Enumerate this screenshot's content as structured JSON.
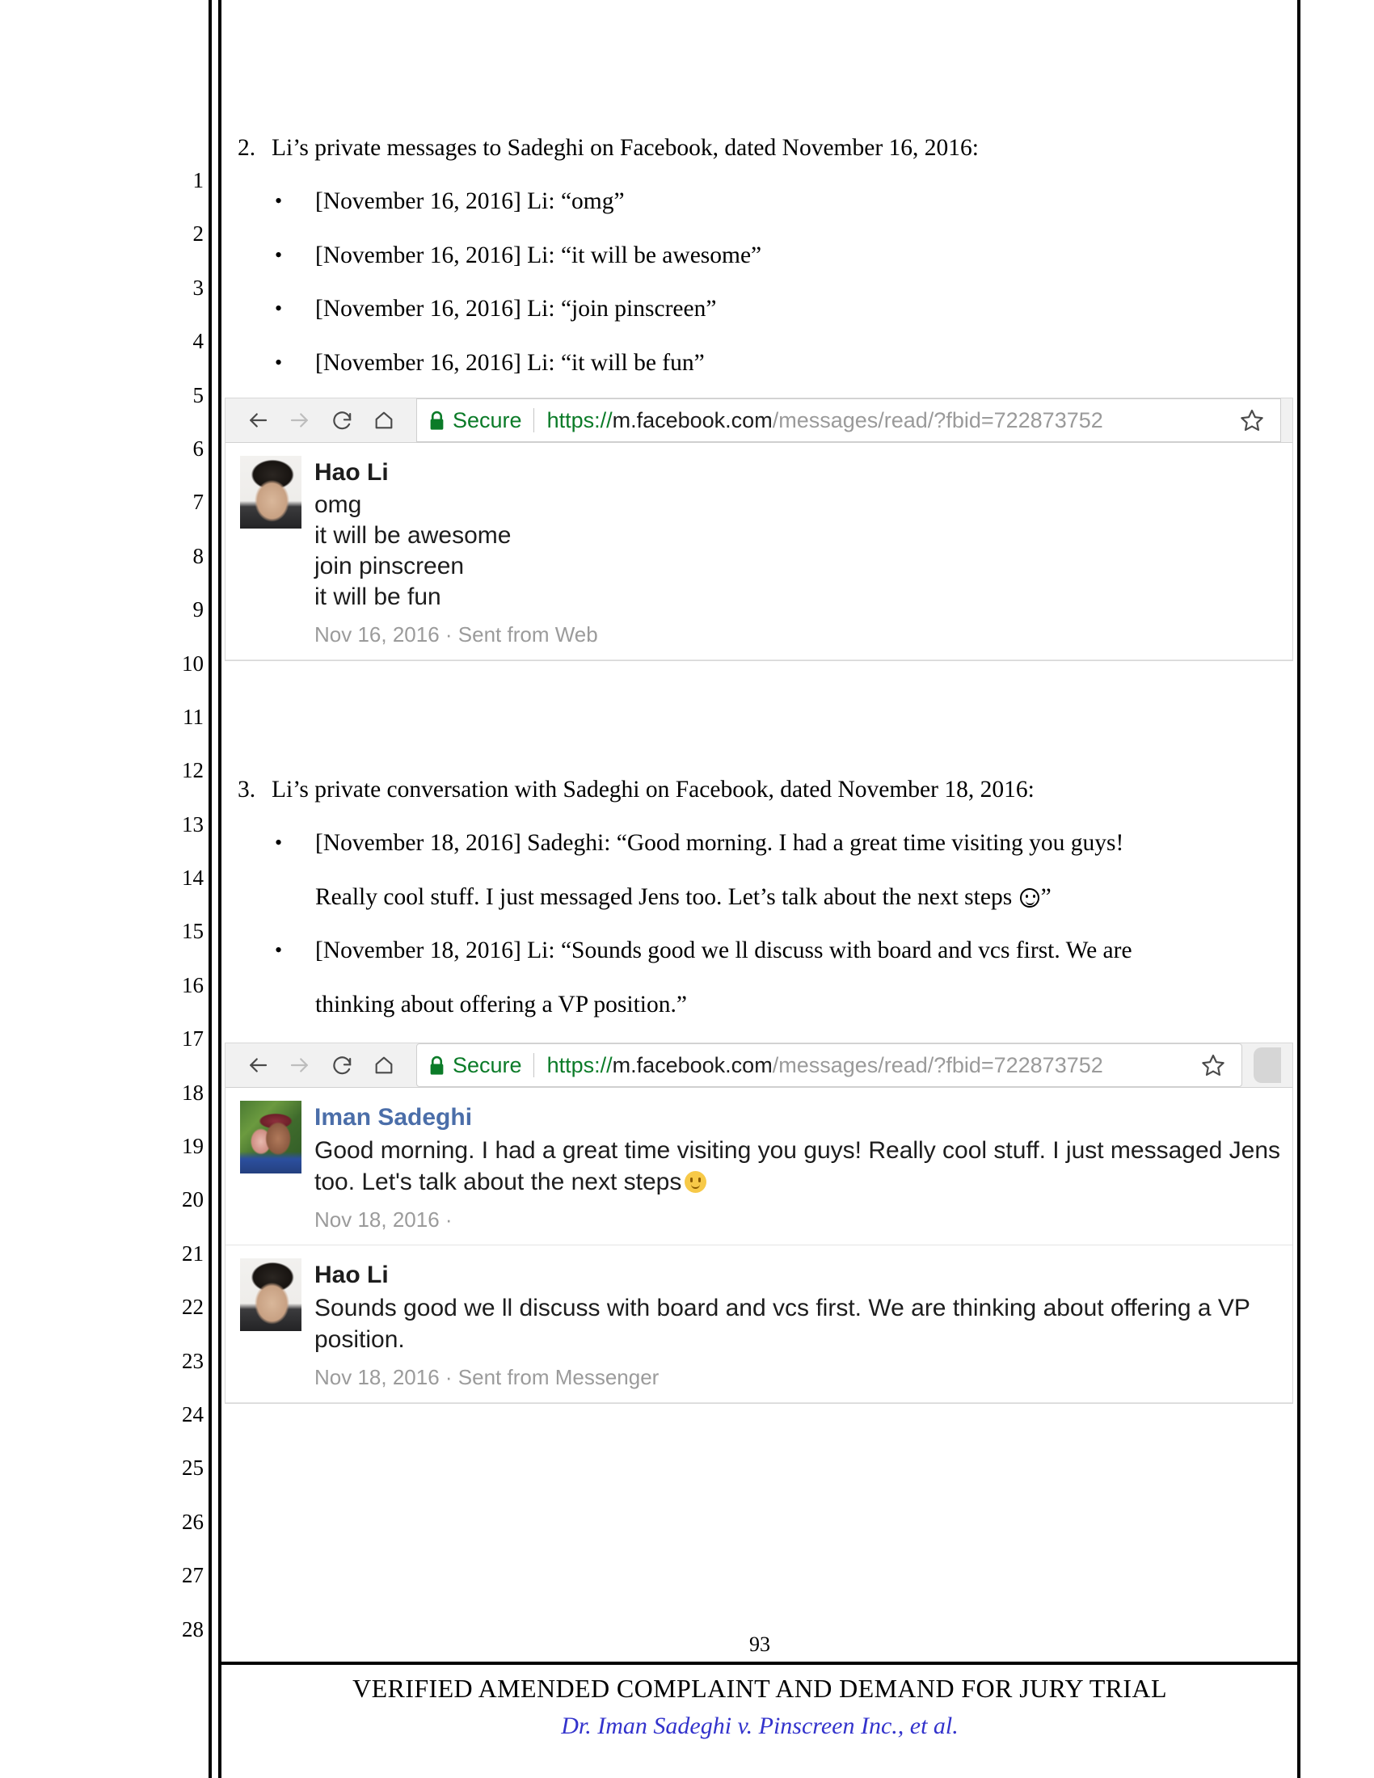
{
  "document": {
    "line_numbers": [
      "1",
      "2",
      "3",
      "4",
      "5",
      "6",
      "7",
      "8",
      "9",
      "10",
      "11",
      "12",
      "13",
      "14",
      "15",
      "16",
      "17",
      "18",
      "19",
      "20",
      "21",
      "22",
      "23",
      "24",
      "25",
      "26",
      "27",
      "28"
    ]
  },
  "section2": {
    "number": "2.",
    "heading": "Li’s private messages to Sadeghi on Facebook, dated November 16, 2016:",
    "bullet_glyph": "•",
    "bullets": [
      "[November 16, 2016] Li: “omg”",
      "[November 16, 2016] Li: “it will be awesome”",
      "[November 16, 2016] Li: “join pinscreen”",
      "[November 16, 2016] Li: “it will be fun”"
    ]
  },
  "screenshot1": {
    "browser": {
      "back_icon": "back-arrow-icon",
      "forward_icon": "forward-arrow-icon",
      "reload_icon": "reload-icon",
      "home_icon": "home-icon",
      "lock_icon": "lock-icon",
      "secure_label": "Secure",
      "url_scheme": "https://",
      "url_host": "m.facebook.com",
      "url_path": "/messages/read/?fbid=722873752",
      "star_icon": "star-bookmark-icon"
    },
    "message": {
      "avatar_name": "hao-li-avatar",
      "author": "Hao Li",
      "lines": [
        "omg",
        "it will be awesome",
        "join pinscreen",
        "it will be fun"
      ],
      "meta": "Nov 16, 2016 · Sent from Web"
    }
  },
  "section3": {
    "number": "3.",
    "heading": "Li’s private conversation with Sadeghi on Facebook, dated November 18, 2016:",
    "bullet_glyph": "•",
    "bullet1_line1": "[November 18, 2016] Sadeghi: “Good morning. I had a great time visiting you guys!",
    "bullet1_line2_a": "Really cool stuff. I just messaged Jens too. Let’s talk about the next steps",
    "bullet1_line2_b": "”",
    "bullet2_line1": "[November 18, 2016] Li: “Sounds good we ll discuss with board and vcs first. We are",
    "bullet2_line2": "thinking about offering a VP position.”"
  },
  "screenshot2": {
    "browser": {
      "back_icon": "back-arrow-icon",
      "forward_icon": "forward-arrow-icon",
      "reload_icon": "reload-icon",
      "home_icon": "home-icon",
      "lock_icon": "lock-icon",
      "secure_label": "Secure",
      "url_scheme": "https://",
      "url_host": "m.facebook.com",
      "url_path": "/messages/read/?fbid=722873752",
      "star_icon": "star-bookmark-icon"
    },
    "messages": [
      {
        "avatar_name": "iman-sadeghi-avatar",
        "author": "Iman Sadeghi",
        "author_color": "#4b6ea9",
        "text_line1": "Good morning. I had a great time visiting you guys! Really cool stuff. I just messaged Jens",
        "text_line2": "too. Let's talk about the next steps",
        "emoji": "smiling-face-emoji",
        "meta": "Nov 18, 2016 ·"
      },
      {
        "avatar_name": "hao-li-avatar",
        "author": "Hao Li",
        "author_color": "#1d1d1d",
        "text_line1": "Sounds good we ll discuss with board and vcs first. We are thinking about offering a VP",
        "text_line2": "position.",
        "meta": "Nov 18, 2016 · Sent from Messenger"
      }
    ]
  },
  "footer": {
    "page_number": "93",
    "title": "VERIFIED AMENDED COMPLAINT AND DEMAND FOR JURY TRIAL",
    "case_name": "Dr. Iman Sadeghi v. Pinscreen Inc., et al.",
    "case_color": "#3333cc"
  }
}
